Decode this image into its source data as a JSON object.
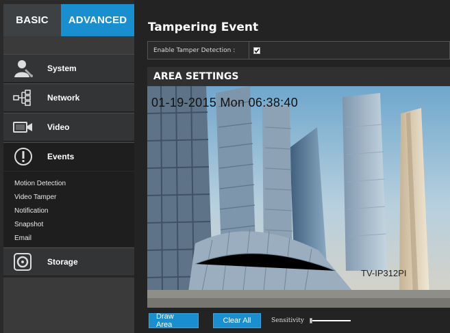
{
  "sidebar": {
    "mode_tabs": {
      "basic": "BASIC",
      "advanced": "ADVANCED"
    },
    "items": [
      {
        "label": "System",
        "icon": "system-user-icon"
      },
      {
        "label": "Network",
        "icon": "network-icon"
      },
      {
        "label": "Video",
        "icon": "video-camera-icon"
      },
      {
        "label": "Events",
        "icon": "alert-icon"
      },
      {
        "label": "Storage",
        "icon": "storage-disk-icon"
      }
    ],
    "events_submenu": [
      "Motion Detection",
      "Video Tamper",
      "Notification",
      "Snapshot",
      "Email"
    ]
  },
  "main": {
    "title": "Tampering Event",
    "tamper": {
      "label": "Enable Tamper Detection :",
      "checked": true
    },
    "area_settings": {
      "header": "AREA SETTINGS",
      "timestamp": "01-19-2015 Mon  06:38:40",
      "camera_name": "TV-IP312PI"
    },
    "controls": {
      "draw_area": "Draw Area",
      "clear_all": "Clear All",
      "sensitivity_label": "Sensitivity",
      "sensitivity_value": 0
    }
  },
  "colors": {
    "accent": "#1a8fd0",
    "sidebar_bg": "#333436",
    "main_bg": "#232323"
  }
}
